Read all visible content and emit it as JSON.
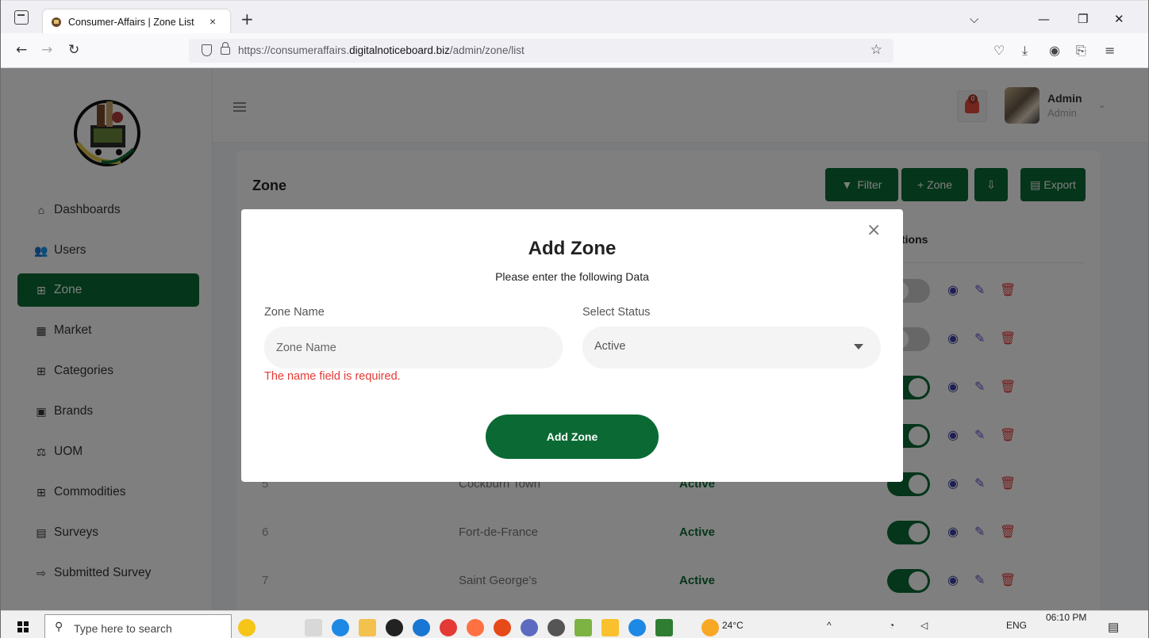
{
  "browser": {
    "tab_title": "Consumer-Affairs | Zone List",
    "tab_close": "×",
    "new_tab": "+",
    "url_prefix": "https://consumeraffairs.",
    "url_domain": "digitalnoticeboard.biz",
    "url_path": "/admin/zone/list"
  },
  "sidebar": {
    "items": [
      {
        "label": "Dashboards",
        "icon": "home-icon"
      },
      {
        "label": "Users",
        "icon": "users-icon"
      },
      {
        "label": "Zone",
        "icon": "grid-icon"
      },
      {
        "label": "Market",
        "icon": "store-icon"
      },
      {
        "label": "Categories",
        "icon": "grid-icon"
      },
      {
        "label": "Brands",
        "icon": "clipboard-icon"
      },
      {
        "label": "UOM",
        "icon": "scale-icon"
      },
      {
        "label": "Commodities",
        "icon": "grid-icon"
      },
      {
        "label": "Surveys",
        "icon": "survey-icon"
      },
      {
        "label": "Submitted Survey",
        "icon": "file-export-icon"
      }
    ],
    "active": "Zone"
  },
  "header": {
    "notification_count": "0",
    "user_name": "Admin",
    "user_role": "Admin"
  },
  "page": {
    "title": "Zone",
    "buttons": {
      "filter": "Filter",
      "add_zone": "+ Zone",
      "export": "Export"
    },
    "actions_header": "tions",
    "rows": [
      {
        "id": "",
        "name": "",
        "status": "",
        "active": false
      },
      {
        "id": "",
        "name": "",
        "status": "",
        "active": false
      },
      {
        "id": "",
        "name": "",
        "status": "",
        "active": true
      },
      {
        "id": "",
        "name": "",
        "status": "",
        "active": true
      },
      {
        "id": "5",
        "name": "Cockburn Town",
        "status": "Active",
        "active": true
      },
      {
        "id": "6",
        "name": "Fort-de-France",
        "status": "Active",
        "active": true
      },
      {
        "id": "7",
        "name": "Saint George's",
        "status": "Active",
        "active": true
      }
    ]
  },
  "modal": {
    "title": "Add Zone",
    "subtitle": "Please enter the following Data",
    "zone_name_label": "Zone Name",
    "zone_name_placeholder": "Zone Name",
    "zone_name_value": "",
    "status_label": "Select Status",
    "status_value": "Active",
    "error": "The name field is required.",
    "submit_label": "Add Zone",
    "close": "×"
  },
  "taskbar": {
    "search_placeholder": "Type here to search",
    "weather": "24°C",
    "language": "ENG",
    "time": "06:10 PM"
  },
  "colors": {
    "brand_green": "#0b6a34",
    "error_red": "#e53935",
    "eye_icon": "#3f3fa8",
    "edit_icon": "#6a4fc8",
    "delete_icon": "#e53935"
  }
}
